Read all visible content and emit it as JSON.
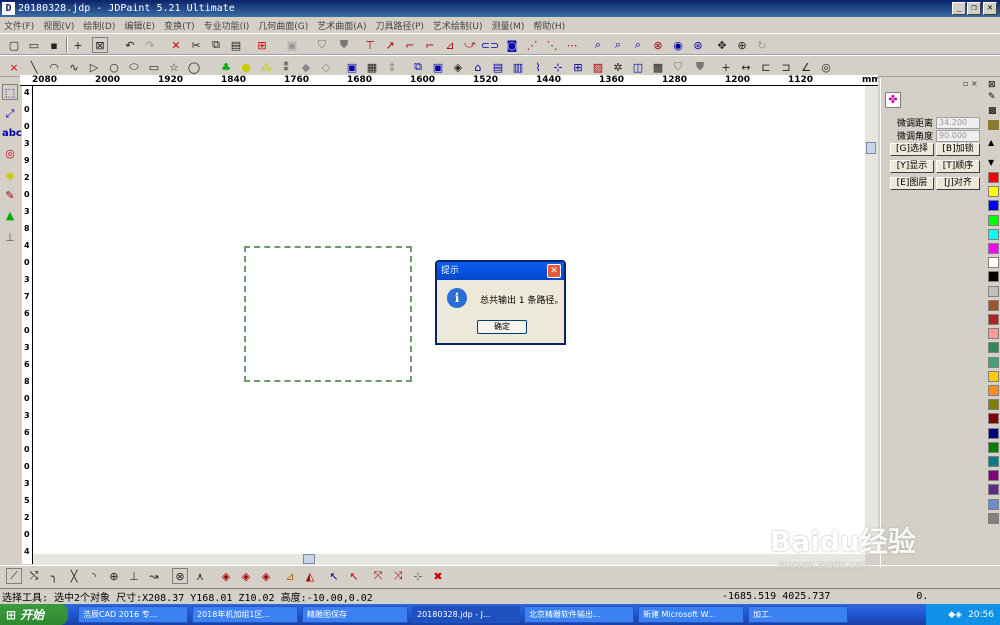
{
  "window": {
    "title": "20180328.jdp - JDPaint 5.21 Ultimate",
    "controls": {
      "minimize": "_",
      "restore": "❐",
      "close": "✕"
    }
  },
  "menu": [
    "文件(F)",
    "视图(V)",
    "绘制(D)",
    "编辑(E)",
    "变换(T)",
    "专业功能(I)",
    "几何曲面(G)",
    "艺术曲面(A)",
    "刀具路径(P)",
    "艺术绘制(U)",
    "测量(M)",
    "帮助(H)"
  ],
  "ruler": {
    "unit": "mm",
    "h_labels": [
      "2080",
      "2000",
      "1920",
      "1840",
      "1760",
      "1680",
      "1600",
      "1520",
      "1440",
      "1360",
      "1280",
      "1200",
      "1120"
    ],
    "v_labels": [
      "4",
      "0",
      "0",
      "3",
      "9",
      "2",
      "0",
      "3",
      "8",
      "4",
      "0",
      "3",
      "7",
      "6",
      "0",
      "3",
      "6",
      "8",
      "0",
      "3",
      "6",
      "0",
      "0",
      "3",
      "5",
      "2",
      "0",
      "4"
    ]
  },
  "panel": {
    "nudge_distance_label": "微调距离",
    "nudge_distance_value": "34.200",
    "nudge_angle_label": "微调角度",
    "nudge_angle_value": "90.000",
    "buttons": [
      "[G]选择",
      "[B]加锁",
      "[Y]显示",
      "[T]顺序",
      "[E]图层",
      "[J]对齐"
    ]
  },
  "palette_colors": [
    "#ff0000",
    "#ffff00",
    "#0000ff",
    "#00ff00",
    "#00ffff",
    "#ff00ff",
    "#ffffff",
    "#000000",
    "#c0c0c0",
    "#a0522d",
    "#b22222",
    "#ff9999",
    "#2e8b57",
    "#40a080",
    "#ffcc00",
    "#ff8c1a",
    "#808000",
    "#800000",
    "#000080",
    "#008000",
    "#008080",
    "#800080",
    "#5a2d82",
    "#6b8cc8",
    "#808080"
  ],
  "dialog": {
    "title": "提示",
    "message": "总共输出 1 条路径。",
    "ok_label": "确定"
  },
  "status": {
    "left": "选择工具: 选中2个对象 尺寸:X208.37 Y168.01 Z10.02 高度:-10.00,0.02",
    "coords": "-1685.519  4025.737",
    "extra": "0."
  },
  "taskbar": {
    "start_label": "开始",
    "tasks": [
      "浩辰CAD 2016 专...",
      "2018年机加组1区...",
      "精雕图保存",
      "20180328.jdp - J...",
      "北京精雕软件输出...",
      "新建 Microsoft W...",
      "加工."
    ],
    "clock": "20:56"
  },
  "watermark": {
    "brand": "Baidu经验",
    "url": "jingyan.baidu.com"
  }
}
